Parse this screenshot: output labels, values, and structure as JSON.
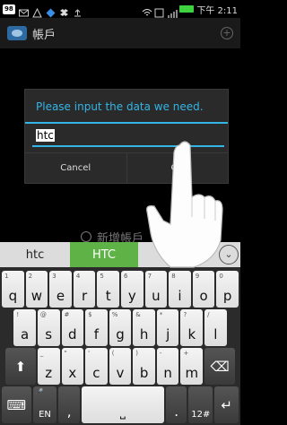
{
  "status_bar": {
    "badge": "98",
    "time": "下午 2:11",
    "battery_color": "#3fd23f"
  },
  "action_bar": {
    "title": "帳戶",
    "add_icon": "plus-circle-icon"
  },
  "background_item": {
    "label": "新增帳戶"
  },
  "dialog": {
    "title": "Please input the data we need.",
    "input_value": "htc",
    "cancel_label": "Cancel",
    "ok_label": "OK",
    "accent_color": "#33b5e5"
  },
  "suggestions": {
    "items": [
      "htc",
      "HTC",
      ""
    ],
    "highlight_color": "#5fb246",
    "expand_icon": "chevron-down-icon"
  },
  "keyboard": {
    "row1": [
      {
        "k": "q",
        "a": "1"
      },
      {
        "k": "w",
        "a": "2"
      },
      {
        "k": "e",
        "a": "3"
      },
      {
        "k": "r",
        "a": "4"
      },
      {
        "k": "t",
        "a": "5"
      },
      {
        "k": "y",
        "a": "6"
      },
      {
        "k": "u",
        "a": "7"
      },
      {
        "k": "i",
        "a": "8"
      },
      {
        "k": "o",
        "a": "9"
      },
      {
        "k": "p",
        "a": "0"
      }
    ],
    "row2": [
      {
        "k": "a",
        "a": "!"
      },
      {
        "k": "s",
        "a": "@"
      },
      {
        "k": "d",
        "a": "#"
      },
      {
        "k": "f",
        "a": "$"
      },
      {
        "k": "g",
        "a": "%"
      },
      {
        "k": "h",
        "a": "&"
      },
      {
        "k": "j",
        "a": "*"
      },
      {
        "k": "k",
        "a": "?"
      },
      {
        "k": "l",
        "a": "/"
      }
    ],
    "row3": [
      {
        "k": "z",
        "a": "_"
      },
      {
        "k": "x",
        "a": "\""
      },
      {
        "k": "c",
        "a": "'"
      },
      {
        "k": "v",
        "a": "("
      },
      {
        "k": "b",
        "a": ")"
      },
      {
        "k": "n",
        "a": "-"
      },
      {
        "k": "m",
        "a": "+"
      }
    ],
    "shift_icon": "shift-arrow-icon",
    "backspace_icon": "backspace-icon",
    "lang_label": "EN",
    "comma": ",",
    "period": ".",
    "num_label": "12#",
    "enter_icon": "enter-icon"
  }
}
